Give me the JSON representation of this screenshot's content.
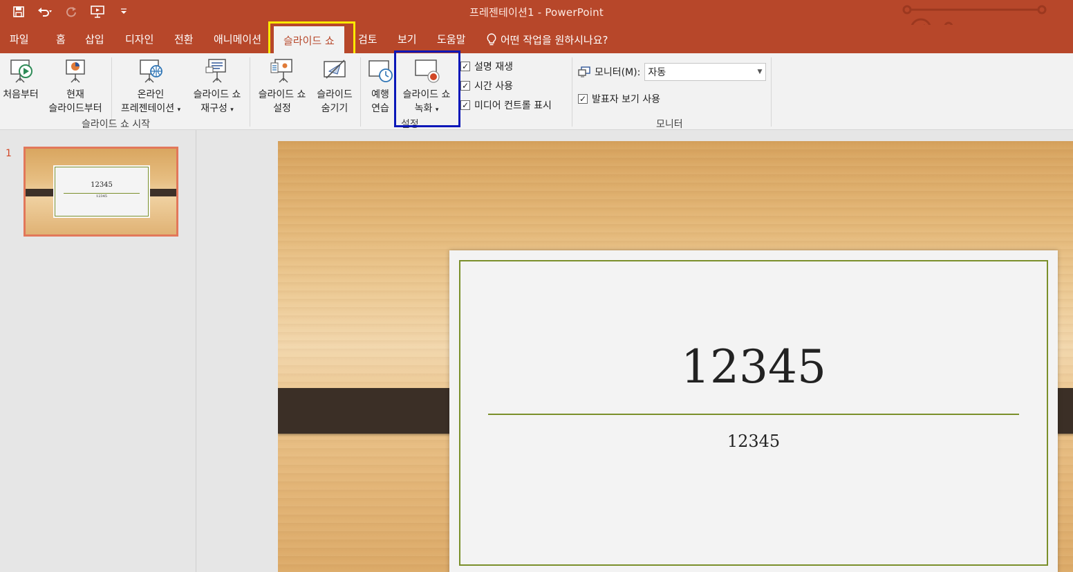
{
  "window": {
    "title": "프레젠테이션1  -  PowerPoint"
  },
  "quick_access": [
    {
      "name": "save-icon",
      "glyph": "💾"
    },
    {
      "name": "undo-icon",
      "glyph": "↶"
    },
    {
      "name": "redo-icon",
      "glyph": "↻"
    },
    {
      "name": "start-from-beginning-icon",
      "glyph": "▣"
    },
    {
      "name": "customize-qat-icon",
      "glyph": "▾"
    }
  ],
  "tabs": [
    {
      "label": "파일"
    },
    {
      "label": "홈"
    },
    {
      "label": "삽입"
    },
    {
      "label": "디자인"
    },
    {
      "label": "전환"
    },
    {
      "label": "애니메이션"
    },
    {
      "label": "슬라이드 쇼",
      "active": true
    },
    {
      "label": "검토"
    },
    {
      "label": "보기"
    },
    {
      "label": "도움말"
    }
  ],
  "tell_me": "어떤 작업을 원하시나요?",
  "ribbon": {
    "start_group": {
      "label": "슬라이드 쇼 시작",
      "from_beginning": "처음부터",
      "from_current_1": "현재",
      "from_current_2": "슬라이드부터",
      "online_1": "온라인",
      "online_2": "프레젠테이션",
      "custom_1": "슬라이드 쇼",
      "custom_2": "재구성"
    },
    "setup_group": {
      "label": "설정",
      "setup_1": "슬라이드 쇼",
      "setup_2": "설정",
      "hide_1": "슬라이드",
      "hide_2": "숨기기",
      "rehearse_1": "예행",
      "rehearse_2": "연습",
      "record_1": "슬라이드 쇼",
      "record_2": "녹화",
      "play_narrations": "설명 재생",
      "use_timings": "시간 사용",
      "show_media_controls": "미디어 컨트롤 표시"
    },
    "monitor_group": {
      "label": "모니터",
      "monitor_label": "모니터(M):",
      "monitor_value": "자동",
      "presenter_view": "발표자 보기 사용"
    }
  },
  "slides_pane": {
    "slide_number": "1"
  },
  "slide": {
    "title": "12345",
    "subtitle": "12345"
  },
  "colors": {
    "accent": "#b7472a",
    "highlight_yellow": "#ffea00",
    "highlight_blue": "#0a17b8",
    "frame_green": "#7a8f2a"
  }
}
